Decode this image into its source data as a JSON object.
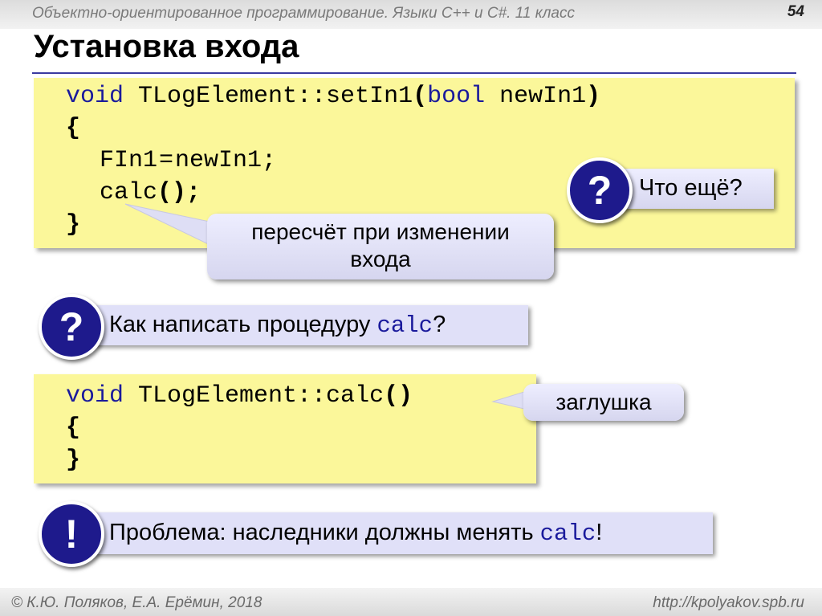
{
  "header": {
    "course": "Объектно-ориентированное программирование. Языки C++ и C#. 11 класс",
    "page_number": "54"
  },
  "slide": {
    "title": "Установка входа"
  },
  "code1": {
    "line1_kw": "void",
    "line1_name": " TLogElement::setIn1",
    "line1_paren_open": "(",
    "line1_param_kw": "bool",
    "line1_param": " newIn1",
    "line1_paren_close": ")",
    "line2": "{",
    "line3_lhs": "FIn1",
    "line3_op": "=",
    "line3_rhs": "newIn1;",
    "line4_name": "calc",
    "line4_parens": "();",
    "line5": "}"
  },
  "callouts": {
    "recalc_line1": "пересчёт при изменении",
    "recalc_line2": "входа",
    "what_else": "Что ещё?",
    "stub": "заглушка"
  },
  "question": {
    "symbol": "?",
    "text": "Как написать процедуру ",
    "code": "calc",
    "end": "?"
  },
  "code2": {
    "line1_kw": "void",
    "line1_name": " TLogElement::calc",
    "line1_parens": "()",
    "line2": "{",
    "line3": "}"
  },
  "problem": {
    "symbol": "!",
    "text": "Проблема: наследники должны менять ",
    "code": "calc",
    "end": "!"
  },
  "what_else_symbol": "?",
  "footer": {
    "authors": "© К.Ю. Поляков, Е.А. Ерёмин, 2018",
    "url": "http://kpolyakov.spb.ru"
  }
}
